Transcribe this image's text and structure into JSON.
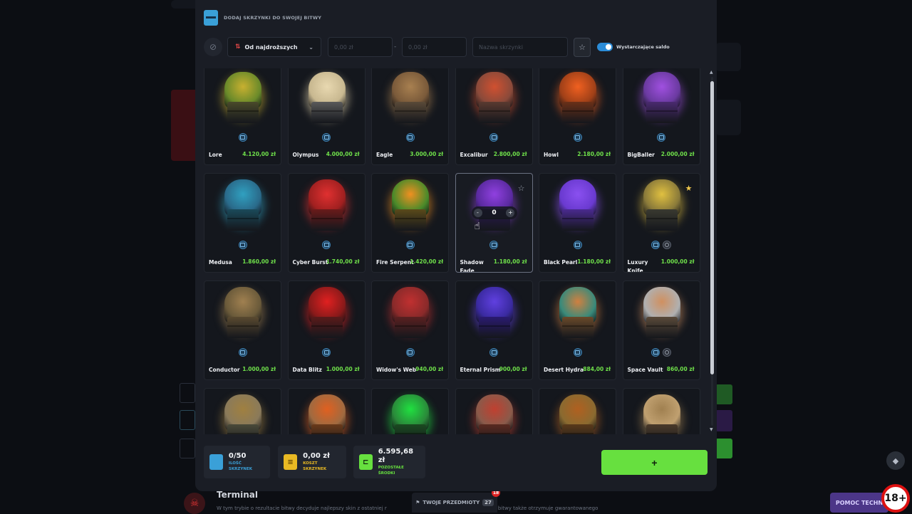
{
  "colors": {
    "accent_green": "#67e03f",
    "price_green": "#6fe04a",
    "accent_blue": "#3aa0d8",
    "modal_bg": "#1a1d25",
    "card_bg": "#14171d"
  },
  "modal": {
    "title": "DODAJ SKRZYNKI DO SWOJEJ BITWY",
    "icon": "case-icon"
  },
  "filters": {
    "sort_label": "Od najdroższych",
    "min_price_placeholder": "0,00 zł",
    "max_price_placeholder": "0,00 zł",
    "dash": "-",
    "search_placeholder": "Nazwa skrzynki",
    "toggle_label": "Wystarczające saldo",
    "toggle_on": true
  },
  "cases": [
    {
      "name": "Lore",
      "price": "4.120,00 zł",
      "glow": "#c8b030",
      "figure": "#6a8a2a",
      "box": "#4a4a2a"
    },
    {
      "name": "Olympus",
      "price": "4.000,00 zł",
      "glow": "#e8d8b0",
      "figure": "#c8b890",
      "box": "#5a5a5a"
    },
    {
      "name": "Eagle",
      "price": "3.000,00 zł",
      "glow": "#a88050",
      "figure": "#7a5a3a",
      "box": "#5a4a38"
    },
    {
      "name": "Excalibur",
      "price": "2.800,00 zł",
      "glow": "#d05030",
      "figure": "#8a4a3a",
      "box": "#5a3a30"
    },
    {
      "name": "Howl",
      "price": "2.180,00 zł",
      "glow": "#f06020",
      "figure": "#a04018",
      "box": "#6a3018"
    },
    {
      "name": "BigBaller",
      "price": "2.000,00 zł",
      "glow": "#a050e0",
      "figure": "#6a3aa0",
      "box": "#4a2a70"
    },
    {
      "name": "Medusa",
      "price": "1.860,00 zł",
      "glow": "#30a0c0",
      "figure": "#2a6a8a",
      "box": "#1a4a5a"
    },
    {
      "name": "Cyber Burst",
      "price": "1.740,00 zł",
      "glow": "#e03030",
      "figure": "#a02020",
      "box": "#6a1a1a"
    },
    {
      "name": "Fire Serpent",
      "price": "1.420,00 zł",
      "glow": "#f09020",
      "figure": "#4a8a2a",
      "box": "#5a4a1a"
    },
    {
      "name": "Shadow Fade",
      "price": "1.180,00 zł",
      "glow": "#9040e0",
      "figure": "#5a2aa0",
      "box": "#2a1a50",
      "starred": false,
      "hover": true,
      "qty": "0",
      "qty_minus": "-",
      "qty_plus": "+"
    },
    {
      "name": "Black Pearl",
      "price": "1.180,00 zł",
      "glow": "#8a50f0",
      "figure": "#6a3ad0",
      "box": "#4a2a90"
    },
    {
      "name": "Luxury Knife",
      "price": "1.000,00 zł",
      "glow": "#e0c040",
      "figure": "#8a7a3a",
      "box": "#3a3a30",
      "starred": true,
      "extra_icon": true
    },
    {
      "name": "Conductor",
      "price": "1.000,00 zł",
      "glow": "#a08050",
      "figure": "#6a5a3a",
      "box": "#5a4a30"
    },
    {
      "name": "Data Blitz",
      "price": "1.000,00 zł",
      "glow": "#e02020",
      "figure": "#8a1a1a",
      "box": "#5a1a1a"
    },
    {
      "name": "Widow's Web",
      "price": "940,00 zł",
      "glow": "#c03030",
      "figure": "#8a2a2a",
      "box": "#5a2020"
    },
    {
      "name": "Eternal Prism",
      "price": "900,00 zł",
      "glow": "#6040e0",
      "figure": "#3a2aa0",
      "box": "#2a1a70"
    },
    {
      "name": "Desert Hydra",
      "price": "884,00 zł",
      "glow": "#d08040",
      "figure": "#3a8a7a",
      "box": "#6a4a2a"
    },
    {
      "name": "Space Vault",
      "price": "860,00 zł",
      "glow": "#d09060",
      "figure": "#b0b0b0",
      "box": "#5a4a3a",
      "extra_icon": true
    },
    {
      "name": "",
      "price": "",
      "glow": "#a08040",
      "figure": "#8a7a5a",
      "box": "#4a4a3a"
    },
    {
      "name": "",
      "price": "",
      "glow": "#e06020",
      "figure": "#a06a40",
      "box": "#6a3a1a"
    },
    {
      "name": "",
      "price": "",
      "glow": "#20e040",
      "figure": "#2a8a3a",
      "box": "#1a4a20"
    },
    {
      "name": "",
      "price": "",
      "glow": "#c04030",
      "figure": "#8a5a4a",
      "box": "#5a2a20"
    },
    {
      "name": "",
      "price": "",
      "glow": "#b06020",
      "figure": "#8a6a30",
      "box": "#5a3a1a"
    },
    {
      "name": "",
      "price": "",
      "glow": "#a08050",
      "figure": "#c0a070",
      "box": "#4a3a2a"
    }
  ],
  "footer": {
    "count_value": "0/50",
    "count_label": "ILOŚĆ SKRZYNEK",
    "cost_value": "0,00 zł",
    "cost_label": "KOSZT SKRZYNEK",
    "balance_value": "6.595,68 zł",
    "balance_label": "POZOSTAŁE ŚRODKI",
    "add_button": "+"
  },
  "background": {
    "terminal_title": "Terminal",
    "terminal_desc": "W tym trybie o rezultacie bitwy decyduje najlepszy skin z ostatniej r",
    "terminal_desc_right": "zników bitwy także otrzymuje gwarantowanego",
    "items_tab": "TWOJE PRZEDMIOTY",
    "items_count": "27",
    "items_notif": "18",
    "help_button": "POMOC TECHN",
    "age_badge": "18+"
  }
}
